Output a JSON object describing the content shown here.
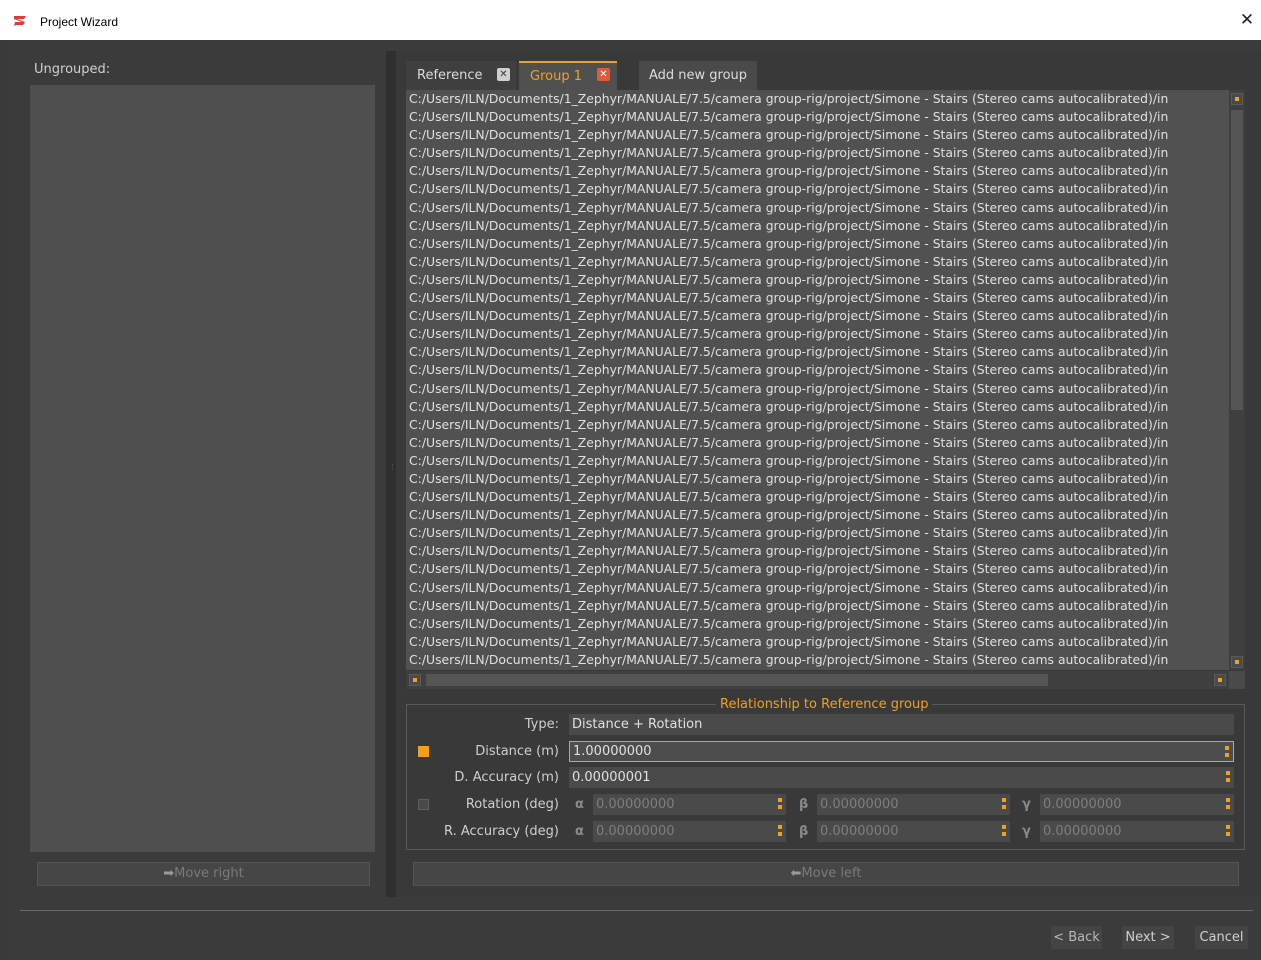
{
  "window": {
    "title": "Project Wizard",
    "logo_color": "#e23a3a"
  },
  "left": {
    "ungrouped_label": "Ungrouped:",
    "move_right_label": "Move right"
  },
  "tabs": [
    {
      "label": "Reference",
      "closable": true
    },
    {
      "label": "Group 1",
      "closable": true,
      "active": true
    },
    {
      "label": "Add new group"
    }
  ],
  "file_list": {
    "path": "C:/Users/ILN/Documents/1_Zephyr/MANUALE/7.5/camera group-rig/project/Simone - Stairs (Stereo cams autocalibrated)/in",
    "visible_rows": 32
  },
  "relationship": {
    "title": "Relationship to Reference group",
    "type_label": "Type:",
    "type_value": "Distance + Rotation",
    "distance_label": "Distance (m)",
    "distance_value": "1.00000000",
    "distance_checked": true,
    "d_accuracy_label": "D. Accuracy (m)",
    "d_accuracy_value": "0.00000001",
    "rotation_label": "Rotation (deg)",
    "rotation_checked": false,
    "rotation": {
      "alpha": "0.00000000",
      "beta": "0.00000000",
      "gamma": "0.00000000"
    },
    "r_accuracy_label": "R. Accuracy (deg)",
    "r_accuracy": {
      "alpha": "0.00000000",
      "beta": "0.00000000",
      "gamma": "0.00000000"
    },
    "greek": {
      "alpha": "α",
      "beta": "β",
      "gamma": "γ"
    }
  },
  "move_left_label": "Move left",
  "nav": {
    "back": "< Back",
    "next": "Next >",
    "cancel": "Cancel"
  },
  "colors": {
    "accent": "#f0a020",
    "close_tab": "#e05a3a"
  }
}
